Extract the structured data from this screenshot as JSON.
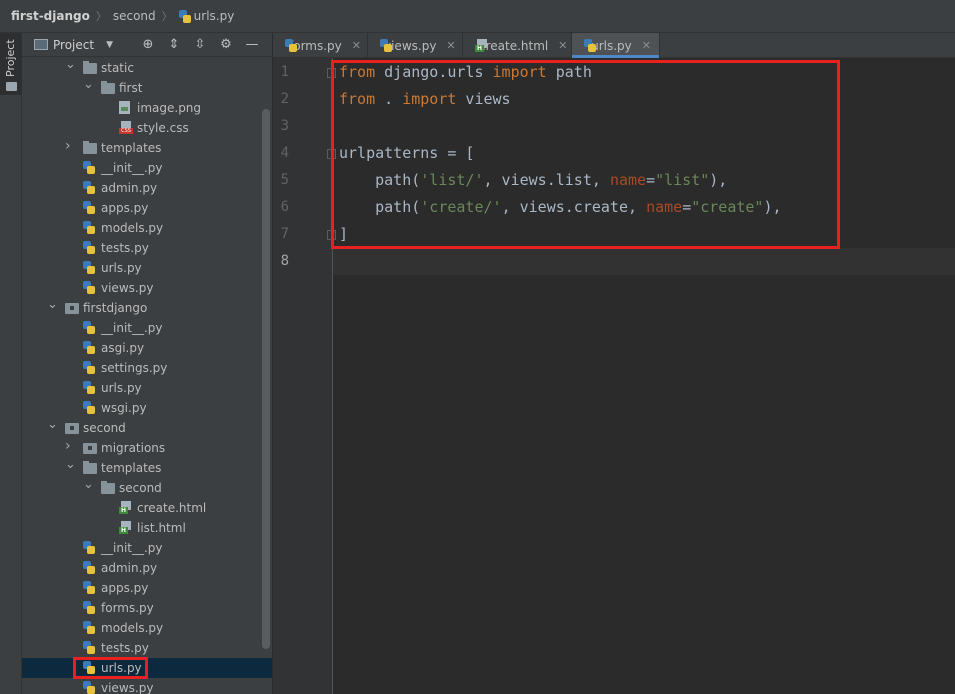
{
  "breadcrumb": {
    "project": "first-django",
    "folder": "second",
    "file": "urls.py"
  },
  "toolstrip": {
    "project_label": "Project"
  },
  "project_panel": {
    "title": "Project",
    "tools": [
      "locate-icon",
      "expand-all-icon",
      "collapse-all-icon",
      "gear-icon",
      "minimize-icon"
    ]
  },
  "tree": [
    {
      "label": "static",
      "type": "folder",
      "depth": 2,
      "expanded": true
    },
    {
      "label": "first",
      "type": "folder",
      "depth": 3,
      "expanded": true
    },
    {
      "label": "image.png",
      "type": "image",
      "depth": 4
    },
    {
      "label": "style.css",
      "type": "css",
      "depth": 4
    },
    {
      "label": "templates",
      "type": "folder",
      "depth": 2,
      "expanded": false
    },
    {
      "label": "__init__.py",
      "type": "py",
      "depth": 2
    },
    {
      "label": "admin.py",
      "type": "py",
      "depth": 2
    },
    {
      "label": "apps.py",
      "type": "py",
      "depth": 2
    },
    {
      "label": "models.py",
      "type": "py",
      "depth": 2
    },
    {
      "label": "tests.py",
      "type": "py",
      "depth": 2
    },
    {
      "label": "urls.py",
      "type": "py",
      "depth": 2
    },
    {
      "label": "views.py",
      "type": "py",
      "depth": 2
    },
    {
      "label": "firstdjango",
      "type": "package",
      "depth": 1,
      "expanded": true
    },
    {
      "label": "__init__.py",
      "type": "py",
      "depth": 2
    },
    {
      "label": "asgi.py",
      "type": "py",
      "depth": 2
    },
    {
      "label": "settings.py",
      "type": "py",
      "depth": 2
    },
    {
      "label": "urls.py",
      "type": "py",
      "depth": 2
    },
    {
      "label": "wsgi.py",
      "type": "py",
      "depth": 2
    },
    {
      "label": "second",
      "type": "package",
      "depth": 1,
      "expanded": true
    },
    {
      "label": "migrations",
      "type": "package",
      "depth": 2,
      "expanded": false
    },
    {
      "label": "templates",
      "type": "folder",
      "depth": 2,
      "expanded": true
    },
    {
      "label": "second",
      "type": "folder",
      "depth": 3,
      "expanded": true
    },
    {
      "label": "create.html",
      "type": "html",
      "depth": 4
    },
    {
      "label": "list.html",
      "type": "html",
      "depth": 4
    },
    {
      "label": "__init__.py",
      "type": "py",
      "depth": 2
    },
    {
      "label": "admin.py",
      "type": "py",
      "depth": 2
    },
    {
      "label": "apps.py",
      "type": "py",
      "depth": 2
    },
    {
      "label": "forms.py",
      "type": "py",
      "depth": 2
    },
    {
      "label": "models.py",
      "type": "py",
      "depth": 2
    },
    {
      "label": "tests.py",
      "type": "py",
      "depth": 2
    },
    {
      "label": "urls.py",
      "type": "py",
      "depth": 2,
      "selected": true
    },
    {
      "label": "views.py",
      "type": "py",
      "depth": 2
    }
  ],
  "tabs": [
    {
      "label": "forms.py",
      "type": "py",
      "active": false
    },
    {
      "label": "views.py",
      "type": "py",
      "active": false
    },
    {
      "label": "create.html",
      "type": "html",
      "active": false
    },
    {
      "label": "urls.py",
      "type": "py",
      "active": true
    }
  ],
  "editor": {
    "current_line": 8,
    "lines": [
      [
        {
          "t": "from",
          "c": "kw"
        },
        {
          "t": " django.urls "
        },
        {
          "t": "import",
          "c": "kw"
        },
        {
          "t": " path"
        }
      ],
      [
        {
          "t": "from",
          "c": "kw"
        },
        {
          "t": " . "
        },
        {
          "t": "import",
          "c": "kw"
        },
        {
          "t": " views"
        }
      ],
      [],
      [
        {
          "t": "urlpatterns = ["
        }
      ],
      [
        {
          "t": "    path("
        },
        {
          "t": "'list/'",
          "c": "str"
        },
        {
          "t": ", views.list, "
        },
        {
          "t": "name",
          "c": "param"
        },
        {
          "t": "="
        },
        {
          "t": "\"list\"",
          "c": "str"
        },
        {
          "t": "),"
        }
      ],
      [
        {
          "t": "    path("
        },
        {
          "t": "'create/'",
          "c": "str"
        },
        {
          "t": ", views.create, "
        },
        {
          "t": "name",
          "c": "param"
        },
        {
          "t": "="
        },
        {
          "t": "\"create\"",
          "c": "str"
        },
        {
          "t": "),"
        }
      ],
      [
        {
          "t": "]"
        }
      ],
      []
    ]
  },
  "colors": {
    "keyword": "#cc7832",
    "string": "#6a8759",
    "param": "#aa4926",
    "highlight_box": "#e8211f",
    "selection": "#0d293e"
  }
}
